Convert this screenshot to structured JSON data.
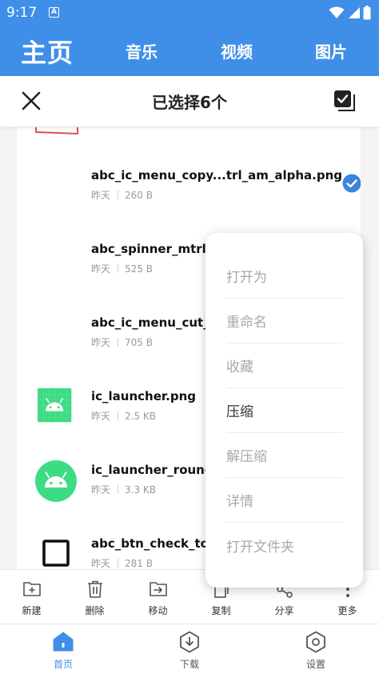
{
  "status_bar": {
    "time": "9:17",
    "badge": "A"
  },
  "app_tabs": {
    "main": "主页",
    "music": "音乐",
    "video": "视频",
    "pictures": "图片"
  },
  "selection_bar": {
    "title": "已选择6个"
  },
  "files": [
    {
      "name": "abc_ic_menu_copy...trl_am_alpha.png",
      "date": "昨天",
      "size": "260 B",
      "icon": "blank",
      "selected": true
    },
    {
      "name": "abc_spinner_mtrl_",
      "date": "昨天",
      "size": "525 B",
      "icon": "blank",
      "selected": false
    },
    {
      "name": "abc_ic_menu_cut_",
      "date": "昨天",
      "size": "705 B",
      "icon": "blank",
      "selected": false
    },
    {
      "name": "ic_launcher.png",
      "date": "昨天",
      "size": "2.5 KB",
      "icon": "android-square-icon",
      "selected": false
    },
    {
      "name": "ic_launcher_round",
      "date": "昨天",
      "size": "3.3 KB",
      "icon": "android-round-icon",
      "selected": false
    },
    {
      "name": "abc_btn_check_to_",
      "date": "昨天",
      "size": "281 B",
      "icon": "checkbox-outline-icon",
      "selected": false
    }
  ],
  "context_menu": {
    "items": [
      "打开为",
      "重命名",
      "收藏",
      "压缩",
      "解压缩",
      "详情",
      "打开文件夹"
    ],
    "active_item": "压缩"
  },
  "action_bar": {
    "new": "新建",
    "delete": "删除",
    "move": "移动",
    "copy": "复制",
    "share": "分享",
    "more": "更多"
  },
  "bottom_nav": {
    "home": "首页",
    "download": "下载",
    "settings": "设置",
    "active": "首页"
  },
  "colors": {
    "primary": "#3f8fe8",
    "check": "#3a86d9",
    "android_green": "#3ddc84"
  }
}
